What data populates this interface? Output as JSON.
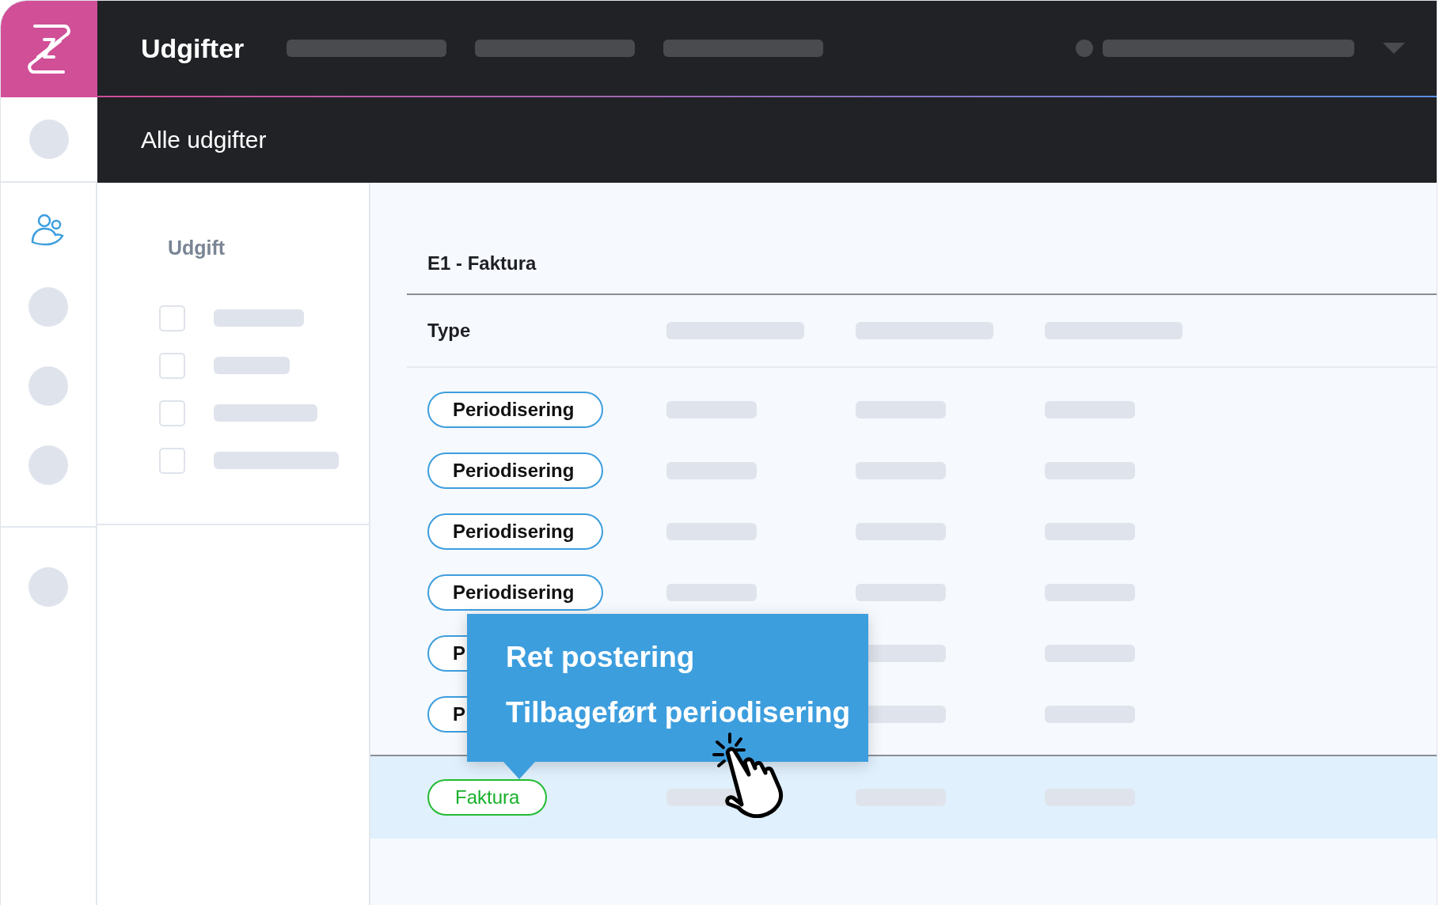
{
  "header": {
    "title": "Udgifter"
  },
  "subheader": {
    "title": "Alle udgifter"
  },
  "filter_panel": {
    "title": "Udgift",
    "options": [
      {
        "checked": false
      },
      {
        "checked": false
      },
      {
        "checked": false
      },
      {
        "checked": false
      }
    ]
  },
  "table": {
    "title": "E1 - Faktura",
    "columns": [
      "Type"
    ],
    "rows": [
      {
        "kind": "periodisering",
        "type": "Periodisering",
        "selected": false
      },
      {
        "kind": "periodisering",
        "type": "Periodisering",
        "selected": false
      },
      {
        "kind": "periodisering",
        "type": "Periodisering",
        "selected": false
      },
      {
        "kind": "periodisering",
        "type": "Periodisering",
        "selected": false
      },
      {
        "kind": "periodisering",
        "type": "P",
        "selected": false
      },
      {
        "kind": "periodisering",
        "type": "P",
        "selected": false
      },
      {
        "kind": "faktura",
        "type": "Faktura",
        "selected": true
      }
    ]
  },
  "context_menu": {
    "items": [
      "Ret postering",
      "Tilbageført periodisering"
    ]
  }
}
